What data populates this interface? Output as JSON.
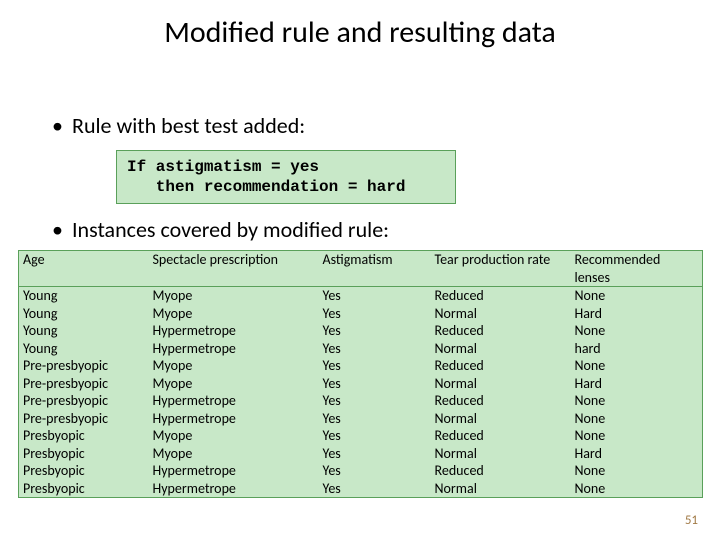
{
  "title": "Modified rule and resulting data",
  "bullets": {
    "b1": "Rule with best test added:",
    "b2": "Instances covered by modified rule:"
  },
  "rule": "If astigmatism = yes\n   then recommendation = hard",
  "page_number": "51",
  "chart_data": {
    "type": "table",
    "headers": {
      "age": "Age",
      "spec": "Spectacle prescription",
      "ast": "Astigmatism",
      "tear": "Tear production rate",
      "rec": "Recommended lenses"
    },
    "rows": [
      {
        "age": "Young",
        "spec": "Myope",
        "ast": "Yes",
        "tear": "Reduced",
        "rec": "None"
      },
      {
        "age": "Young",
        "spec": "Myope",
        "ast": "Yes",
        "tear": "Normal",
        "rec": "Hard"
      },
      {
        "age": "Young",
        "spec": "Hypermetrope",
        "ast": "Yes",
        "tear": "Reduced",
        "rec": "None"
      },
      {
        "age": "Young",
        "spec": "Hypermetrope",
        "ast": "Yes",
        "tear": "Normal",
        "rec": "hard"
      },
      {
        "age": "Pre-presbyopic",
        "spec": "Myope",
        "ast": "Yes",
        "tear": "Reduced",
        "rec": "None"
      },
      {
        "age": "Pre-presbyopic",
        "spec": "Myope",
        "ast": "Yes",
        "tear": "Normal",
        "rec": "Hard"
      },
      {
        "age": "Pre-presbyopic",
        "spec": "Hypermetrope",
        "ast": "Yes",
        "tear": "Reduced",
        "rec": "None"
      },
      {
        "age": "Pre-presbyopic",
        "spec": "Hypermetrope",
        "ast": "Yes",
        "tear": "Normal",
        "rec": "None"
      },
      {
        "age": "Presbyopic",
        "spec": "Myope",
        "ast": "Yes",
        "tear": "Reduced",
        "rec": "None"
      },
      {
        "age": "Presbyopic",
        "spec": "Myope",
        "ast": "Yes",
        "tear": "Normal",
        "rec": "Hard"
      },
      {
        "age": "Presbyopic",
        "spec": "Hypermetrope",
        "ast": "Yes",
        "tear": "Reduced",
        "rec": "None"
      },
      {
        "age": "Presbyopic",
        "spec": "Hypermetrope",
        "ast": "Yes",
        "tear": "Normal",
        "rec": "None"
      }
    ]
  }
}
